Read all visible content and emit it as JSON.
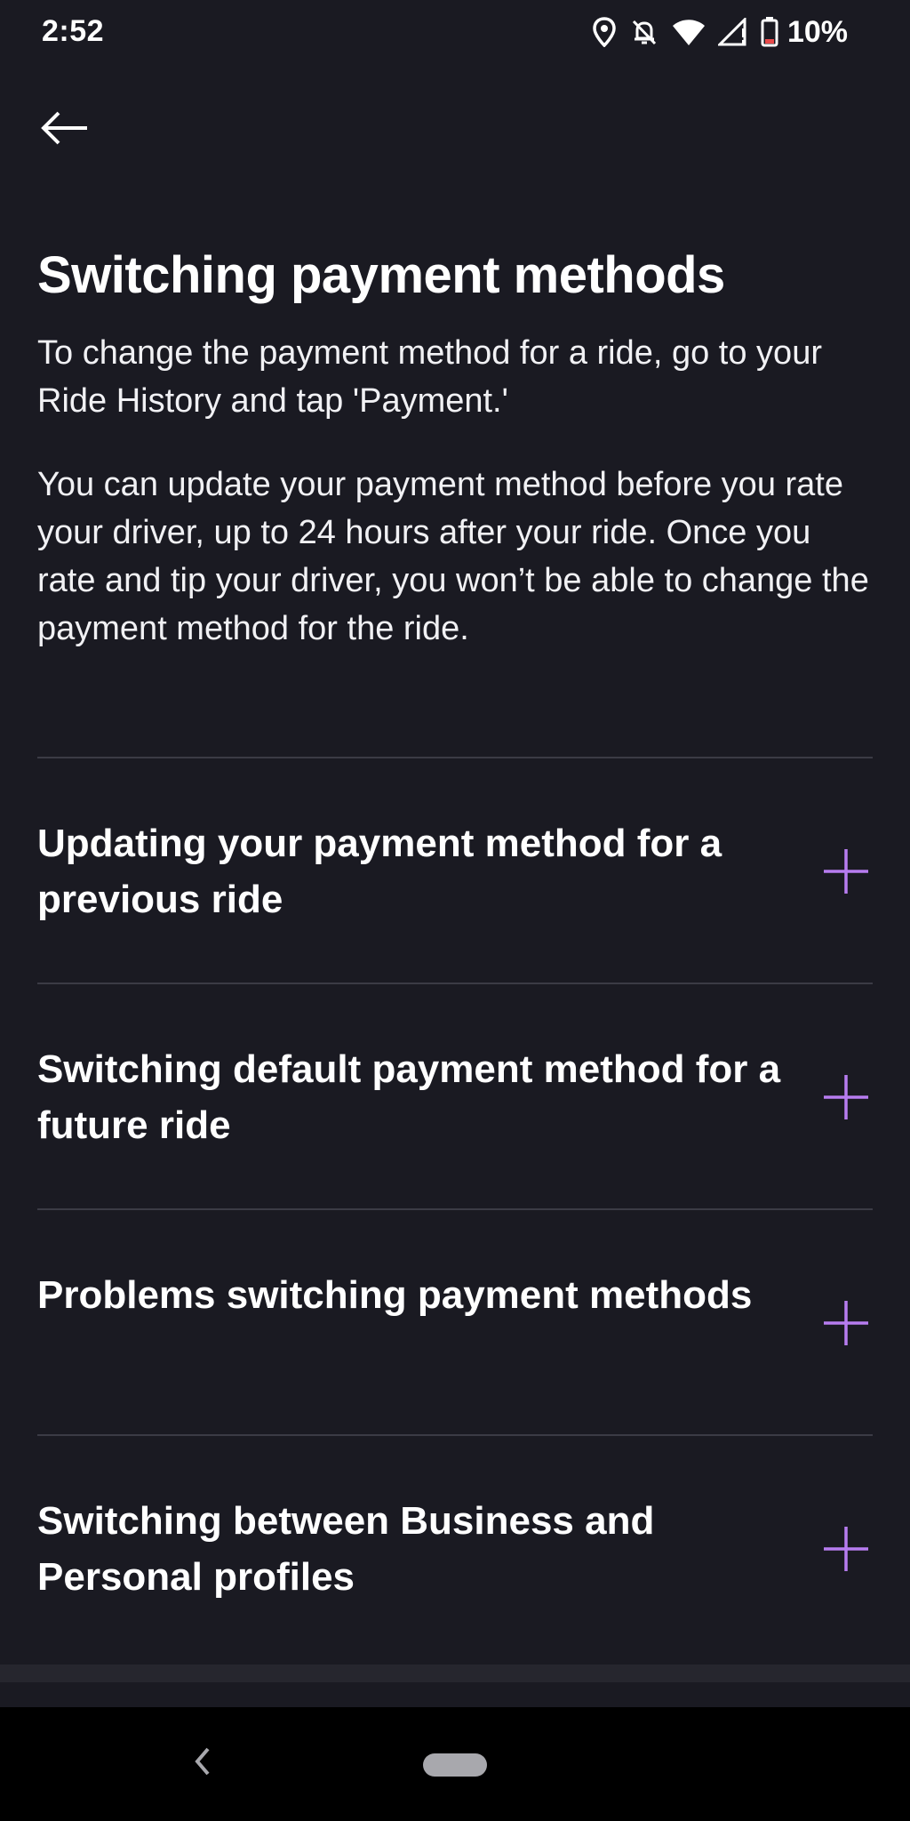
{
  "status_bar": {
    "time": "2:52",
    "battery": "10%",
    "icons": [
      "location-icon",
      "notifications-off-icon",
      "wifi-icon",
      "cell-signal-icon",
      "battery-low-icon"
    ]
  },
  "header": {
    "back_icon": "arrow-left-icon"
  },
  "article": {
    "title": "Switching payment methods",
    "paragraphs": [
      "To change the payment method for a ride, go to your Ride History and tap 'Payment.'",
      "You can update your payment method before you rate your driver, up to 24 hours after your ride. Once you rate and tip your driver, you won’t be able to change the payment method for the ride."
    ]
  },
  "faq": {
    "expand_icon": "plus-icon",
    "accent_color": "#b77cf0",
    "items": [
      {
        "title": "Updating your payment method for a previous ride"
      },
      {
        "title": "Switching default payment method for a future ride"
      },
      {
        "title": "Problems switching payment methods"
      },
      {
        "title": "Switching between Business and Personal profiles"
      }
    ]
  },
  "navigation_bar": {
    "back_icon": "chevron-left-icon",
    "home_icon": "home-pill-icon"
  },
  "colors": {
    "background": "#1a1a22",
    "divider": "#3b3b45",
    "text": "#ffffff"
  }
}
